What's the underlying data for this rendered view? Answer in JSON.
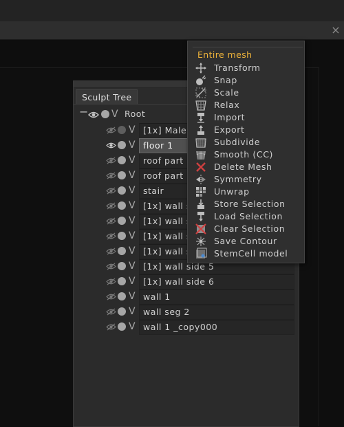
{
  "window": {
    "close_glyph": "×"
  },
  "panel": {
    "tab_label": "Sculpt Tree",
    "root_label": "Root",
    "collapse_glyph": "−",
    "rows": [
      {
        "name": "[1x] Male",
        "hidden": true,
        "selected": false
      },
      {
        "name": "floor 1",
        "hidden": false,
        "selected": true
      },
      {
        "name": "roof part",
        "hidden": true,
        "selected": false
      },
      {
        "name": "roof part",
        "hidden": true,
        "selected": false
      },
      {
        "name": "stair",
        "hidden": true,
        "selected": false
      },
      {
        "name": "[1x]  wall s",
        "hidden": true,
        "selected": false
      },
      {
        "name": "[1x]  wall s",
        "hidden": true,
        "selected": false
      },
      {
        "name": "[1x]  wall s",
        "hidden": true,
        "selected": false
      },
      {
        "name": "[1x]  wall s",
        "hidden": true,
        "selected": false
      },
      {
        "name": "[1x]  wall side 5",
        "hidden": true,
        "selected": false
      },
      {
        "name": "[1x]  wall side 6",
        "hidden": true,
        "selected": false
      },
      {
        "name": "wall 1",
        "hidden": true,
        "selected": false
      },
      {
        "name": "wall seg 2",
        "hidden": true,
        "selected": false
      },
      {
        "name": "wall 1 _copy000",
        "hidden": true,
        "selected": false
      }
    ]
  },
  "menu": {
    "header": "Entire mesh",
    "header_color": "#f0b43a",
    "items": [
      {
        "label": "Transform",
        "icon": "transform-icon"
      },
      {
        "label": "Snap",
        "icon": "snap-icon"
      },
      {
        "label": "Scale",
        "icon": "scale-icon"
      },
      {
        "label": "Relax",
        "icon": "relax-icon"
      },
      {
        "label": "Import",
        "icon": "import-icon"
      },
      {
        "label": "Export",
        "icon": "export-icon"
      },
      {
        "label": "Subdivide",
        "icon": "subdivide-icon"
      },
      {
        "label": "Smooth (CC)",
        "icon": "smooth-icon"
      },
      {
        "label": "Delete Mesh",
        "icon": "delete-icon"
      },
      {
        "label": "Symmetry",
        "icon": "symmetry-icon"
      },
      {
        "label": "Unwrap",
        "icon": "unwrap-icon"
      },
      {
        "label": "Store Selection",
        "icon": "store-selection-icon"
      },
      {
        "label": "Load Selection",
        "icon": "load-selection-icon"
      },
      {
        "label": "Clear Selection",
        "icon": "clear-selection-icon"
      },
      {
        "label": "Save Contour",
        "icon": "save-contour-icon"
      },
      {
        "label": "StemCell model",
        "icon": "stemcell-icon"
      }
    ]
  }
}
